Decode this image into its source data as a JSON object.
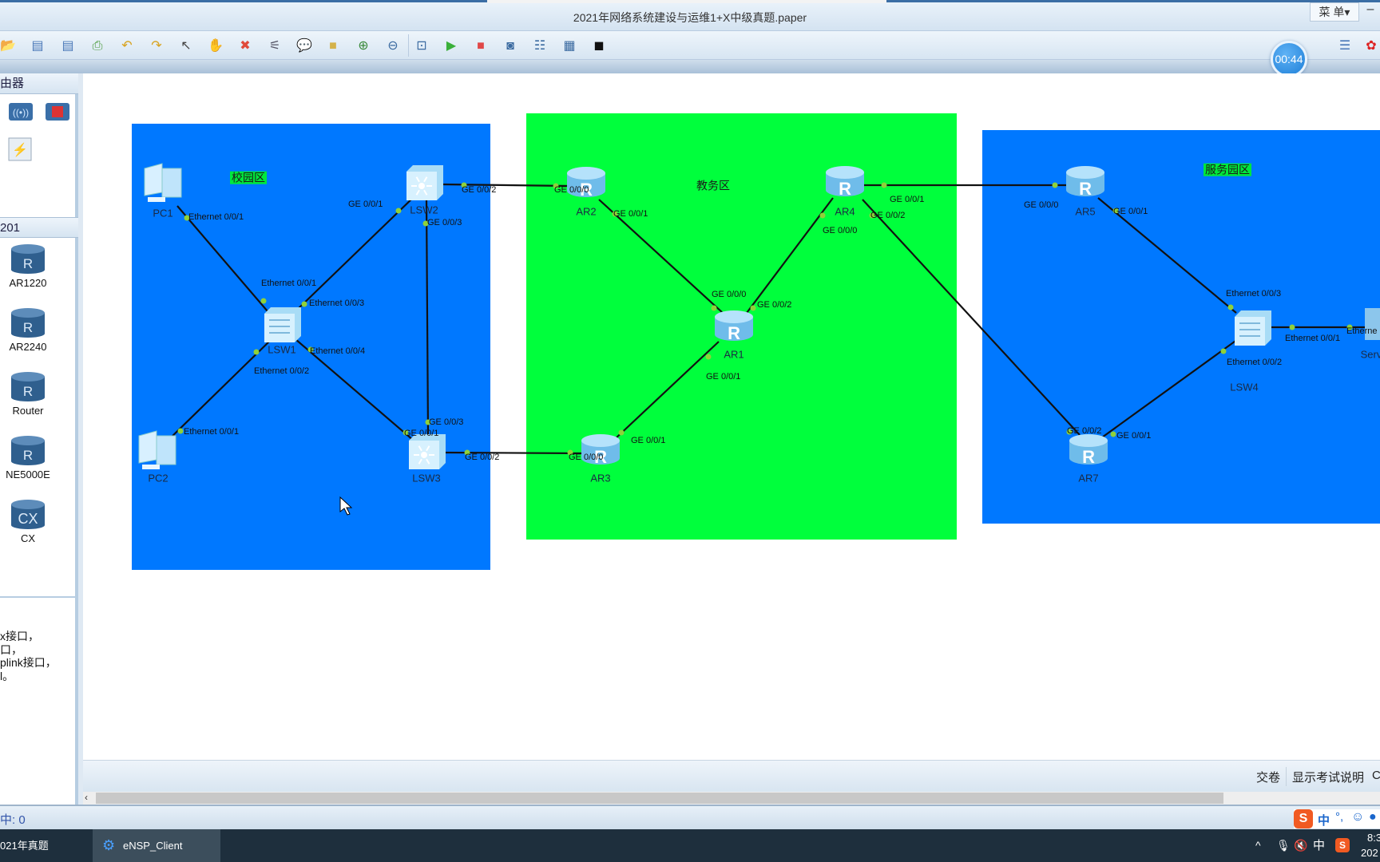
{
  "window": {
    "title": "2021年网络系统建设与运维1+X中级真题.paper",
    "menu_label": "菜 单▾",
    "minimize_label": "–"
  },
  "toolbar": {
    "items": [
      {
        "name": "open-icon",
        "glyph": "📂",
        "color": "#e8b33c"
      },
      {
        "name": "save-icon",
        "glyph": "▤",
        "color": "#4a78b8"
      },
      {
        "name": "save-as-icon",
        "glyph": "▤",
        "color": "#4a78b8"
      },
      {
        "name": "print-icon",
        "glyph": "⎙",
        "color": "#4a9a3a"
      },
      {
        "name": "undo-icon",
        "glyph": "↶",
        "color": "#d8a21c"
      },
      {
        "name": "redo-icon",
        "glyph": "↷",
        "color": "#d8a21c"
      },
      {
        "name": "select-pointer-icon",
        "glyph": "↖",
        "color": "#444"
      },
      {
        "name": "pan-hand-icon",
        "glyph": "✋",
        "color": "#e0b060"
      },
      {
        "name": "delete-icon",
        "glyph": "✖",
        "color": "#e04a3a"
      },
      {
        "name": "delete-link-icon",
        "glyph": "⚟",
        "color": "#556"
      },
      {
        "name": "text-note-icon",
        "glyph": "💬",
        "color": "#4a9a3a"
      },
      {
        "name": "palette-icon",
        "glyph": "■",
        "color": "#d4b24a"
      },
      {
        "name": "zoom-in-icon",
        "glyph": "⊕",
        "color": "#3a8a3a"
      },
      {
        "name": "zoom-out-icon",
        "glyph": "⊖",
        "color": "#3a6aa0"
      },
      {
        "name": "fit-view-icon",
        "glyph": "⊡",
        "color": "#3a6aa0"
      },
      {
        "name": "start-device-icon",
        "glyph": "▶",
        "color": "#3ab03a"
      },
      {
        "name": "stop-device-icon",
        "glyph": "■",
        "color": "#e04848"
      },
      {
        "name": "capture-icon",
        "glyph": "◙",
        "color": "#3a6aa0"
      },
      {
        "name": "topology-icon",
        "glyph": "☷",
        "color": "#3a6aa0"
      },
      {
        "name": "table-icon",
        "glyph": "▦",
        "color": "#3a6aa0"
      },
      {
        "name": "console-icon",
        "glyph": "◼",
        "color": "#111"
      }
    ],
    "right_items": [
      {
        "name": "chat-icon",
        "glyph": "☰",
        "color": "#4a78b8"
      },
      {
        "name": "huawei-logo-icon",
        "glyph": "✿",
        "color": "#d22"
      }
    ]
  },
  "timer": "00:44",
  "left_panel": {
    "section1_title": "由器",
    "section2_title": "201",
    "devices": [
      {
        "label": "AR1220"
      },
      {
        "label": "AR2240"
      },
      {
        "label": "Router"
      },
      {
        "label": "NE5000E"
      },
      {
        "label": "CX"
      }
    ],
    "help_lines": [
      "x接口，",
      "口，",
      "plink接口，",
      "l。"
    ]
  },
  "topology": {
    "zones": [
      {
        "label": "校园区",
        "color": "#0078ff",
        "label_bg": "#00e83c"
      },
      {
        "label": "教务区",
        "color": "#00ff3c",
        "label_bg": ""
      },
      {
        "label": "服务园区",
        "color": "#0078ff",
        "label_bg": "#00e83c"
      }
    ],
    "nodes": [
      {
        "id": "PC1",
        "kind": "pc"
      },
      {
        "id": "PC2",
        "kind": "pc"
      },
      {
        "id": "LSW1",
        "kind": "switch"
      },
      {
        "id": "LSW2",
        "kind": "l3switch"
      },
      {
        "id": "LSW3",
        "kind": "l3switch"
      },
      {
        "id": "AR1",
        "kind": "router"
      },
      {
        "id": "AR2",
        "kind": "router"
      },
      {
        "id": "AR3",
        "kind": "router"
      },
      {
        "id": "AR4",
        "kind": "router"
      },
      {
        "id": "AR5",
        "kind": "router"
      },
      {
        "id": "AR7",
        "kind": "router"
      },
      {
        "id": "LSW4",
        "kind": "switch"
      },
      {
        "id": "Serv",
        "kind": "server"
      }
    ],
    "links": [
      {
        "a": "PC1",
        "a_port": "Ethernet 0/0/1",
        "b": "LSW1",
        "b_port": "Ethernet 0/0/1"
      },
      {
        "a": "LSW1",
        "a_port": "Ethernet 0/0/3",
        "b": "LSW2",
        "b_port": "GE 0/0/1"
      },
      {
        "a": "LSW1",
        "a_port": "Ethernet 0/0/2",
        "b": "PC2",
        "b_port": "Ethernet 0/0/1"
      },
      {
        "a": "LSW1",
        "a_port": "Ethernet 0/0/4",
        "b": "LSW3",
        "b_port": "GE 0/0/1"
      },
      {
        "a": "LSW2",
        "a_port": "GE 0/0/3",
        "b": "LSW3",
        "b_port": "GE 0/0/3"
      },
      {
        "a": "LSW2",
        "a_port": "GE 0/0/2",
        "b": "AR2",
        "b_port": "GE 0/0/0"
      },
      {
        "a": "LSW3",
        "a_port": "GE 0/0/2",
        "b": "AR3",
        "b_port": "GE 0/0/0"
      },
      {
        "a": "AR2",
        "a_port": "GE 0/0/1",
        "b": "AR1",
        "b_port": "GE 0/0/0"
      },
      {
        "a": "AR1",
        "a_port": "GE 0/0/2",
        "b": "AR4",
        "b_port": "GE 0/0/0"
      },
      {
        "a": "AR1",
        "a_port": "GE 0/0/1",
        "b": "AR3",
        "b_port": "GE 0/0/1"
      },
      {
        "a": "AR4",
        "a_port": "GE 0/0/1",
        "b": "AR5",
        "b_port": "GE 0/0/0"
      },
      {
        "a": "AR4",
        "a_port": "GE 0/0/2",
        "b": "AR7",
        "b_port": "GE 0/0/2"
      },
      {
        "a": "AR5",
        "a_port": "GE 0/0/1",
        "b": "LSW4",
        "b_port": "Ethernet 0/0/3"
      },
      {
        "a": "AR7",
        "a_port": "GE 0/0/1",
        "b": "LSW4",
        "b_port": "Ethernet 0/0/2"
      },
      {
        "a": "LSW4",
        "a_port": "Ethernet 0/0/1",
        "b": "Serv",
        "b_port": "Etherne"
      }
    ],
    "port_dot_color": "#8fd13a"
  },
  "bottom": {
    "submit": "交卷",
    "show_instructions": "显示考试说明",
    "cut_text": "C"
  },
  "status": {
    "text": "中: 0"
  },
  "taskbar": {
    "items": [
      "021年真题",
      "eNSP_Client"
    ],
    "clock_time": "8:3",
    "clock_date": "202",
    "ime_label": "中",
    "tray_ime": "中"
  }
}
